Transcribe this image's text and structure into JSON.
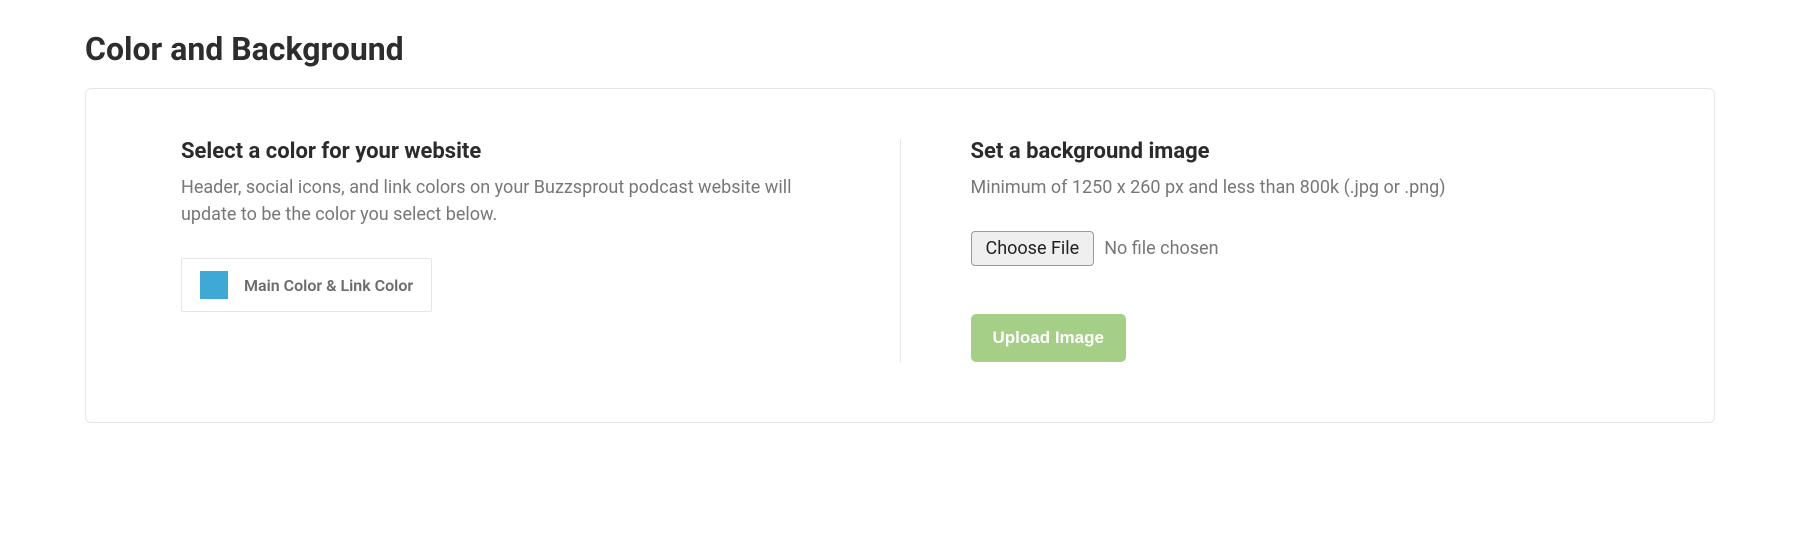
{
  "page_title": "Color and Background",
  "color_section": {
    "heading": "Select a color for your website",
    "description": "Header, social icons, and link colors on your Buzzsprout podcast website will update to be the color you select below.",
    "swatch_color": "#3fa9d6",
    "label": "Main Color & Link Color"
  },
  "background_section": {
    "heading": "Set a background image",
    "description": "Minimum of 1250 x 260 px and less than 800k (.jpg or .png)",
    "choose_file_label": "Choose File",
    "file_status": "No file chosen",
    "upload_button_label": "Upload Image"
  }
}
